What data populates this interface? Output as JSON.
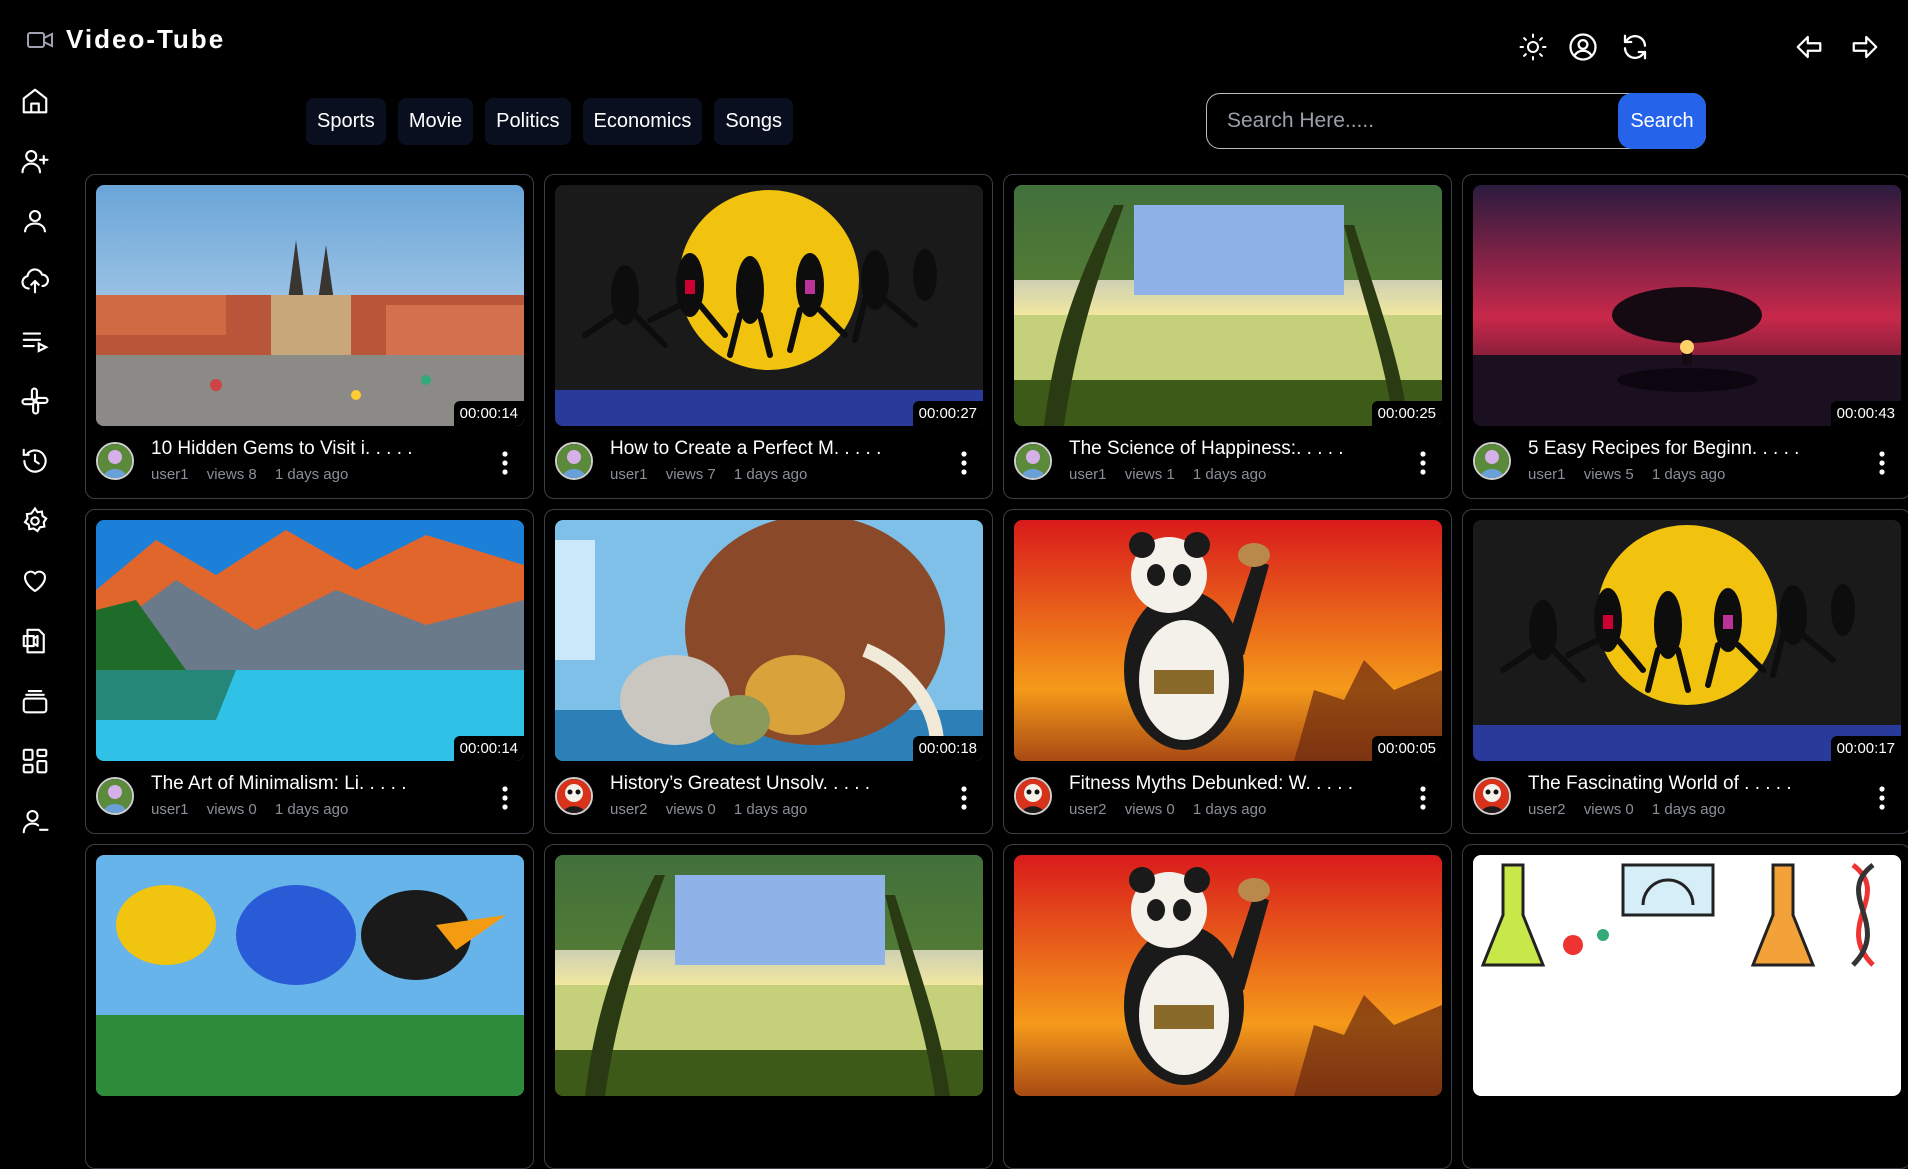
{
  "app": {
    "title": "Video-Tube",
    "accent": "#2563eb"
  },
  "header_icons": [
    "sun-icon",
    "user-circle-icon",
    "refresh-icon",
    "back-arrow-icon",
    "forward-arrow-icon"
  ],
  "sidebar_icons": [
    "home-icon",
    "add-user-icon",
    "user-icon",
    "upload-cloud-icon",
    "playlist-icon",
    "slack-icon",
    "history-icon",
    "settings-icon",
    "heart-icon",
    "my-videos-icon",
    "collections-icon",
    "dashboard-icon",
    "logout-user-icon"
  ],
  "categories": [
    "Sports",
    "Movie",
    "Politics",
    "Economics",
    "Songs"
  ],
  "search": {
    "placeholder": "Search Here.....",
    "button": "Search"
  },
  "videos": [
    {
      "title": "10 Hidden Gems to Visit i. . . . .",
      "user": "user1",
      "views": "views 8",
      "age": "1 days ago",
      "duration": "00:00:14",
      "thumb": "city"
    },
    {
      "title": "How to Create a Perfect M. . . . .",
      "user": "user1",
      "views": "views 7",
      "age": "1 days ago",
      "duration": "00:00:27",
      "thumb": "dance"
    },
    {
      "title": "The Science of Happiness:. . . . .",
      "user": "user1",
      "views": "views 1",
      "age": "1 days ago",
      "duration": "00:00:25",
      "thumb": "lake"
    },
    {
      "title": "5 Easy Recipes for Beginn. . . . .",
      "user": "user1",
      "views": "views 5",
      "age": "1 days ago",
      "duration": "00:00:43",
      "thumb": "sunset"
    },
    {
      "title": "The Art of Minimalism: Li. . . . .",
      "user": "user1",
      "views": "views 0",
      "age": "1 days ago",
      "duration": "00:00:14",
      "thumb": "mountains"
    },
    {
      "title": "History’s Greatest Unsolv. . . . .",
      "user": "user2",
      "views": "views 0",
      "age": "1 days ago",
      "duration": "00:00:18",
      "thumb": "iceage"
    },
    {
      "title": "Fitness Myths Debunked: W. . . . .",
      "user": "user2",
      "views": "views 0",
      "age": "1 days ago",
      "duration": "00:00:05",
      "thumb": "panda"
    },
    {
      "title": "The Fascinating World of . . . . .",
      "user": "user2",
      "views": "views 0",
      "age": "1 days ago",
      "duration": "00:00:17",
      "thumb": "dance"
    },
    {
      "title": "",
      "user": "",
      "views": "",
      "age": "",
      "duration": "",
      "thumb": "birds"
    },
    {
      "title": "",
      "user": "",
      "views": "",
      "age": "",
      "duration": "",
      "thumb": "lake"
    },
    {
      "title": "",
      "user": "",
      "views": "",
      "age": "",
      "duration": "",
      "thumb": "panda"
    },
    {
      "title": "",
      "user": "",
      "views": "",
      "age": "",
      "duration": "",
      "thumb": "science"
    }
  ]
}
